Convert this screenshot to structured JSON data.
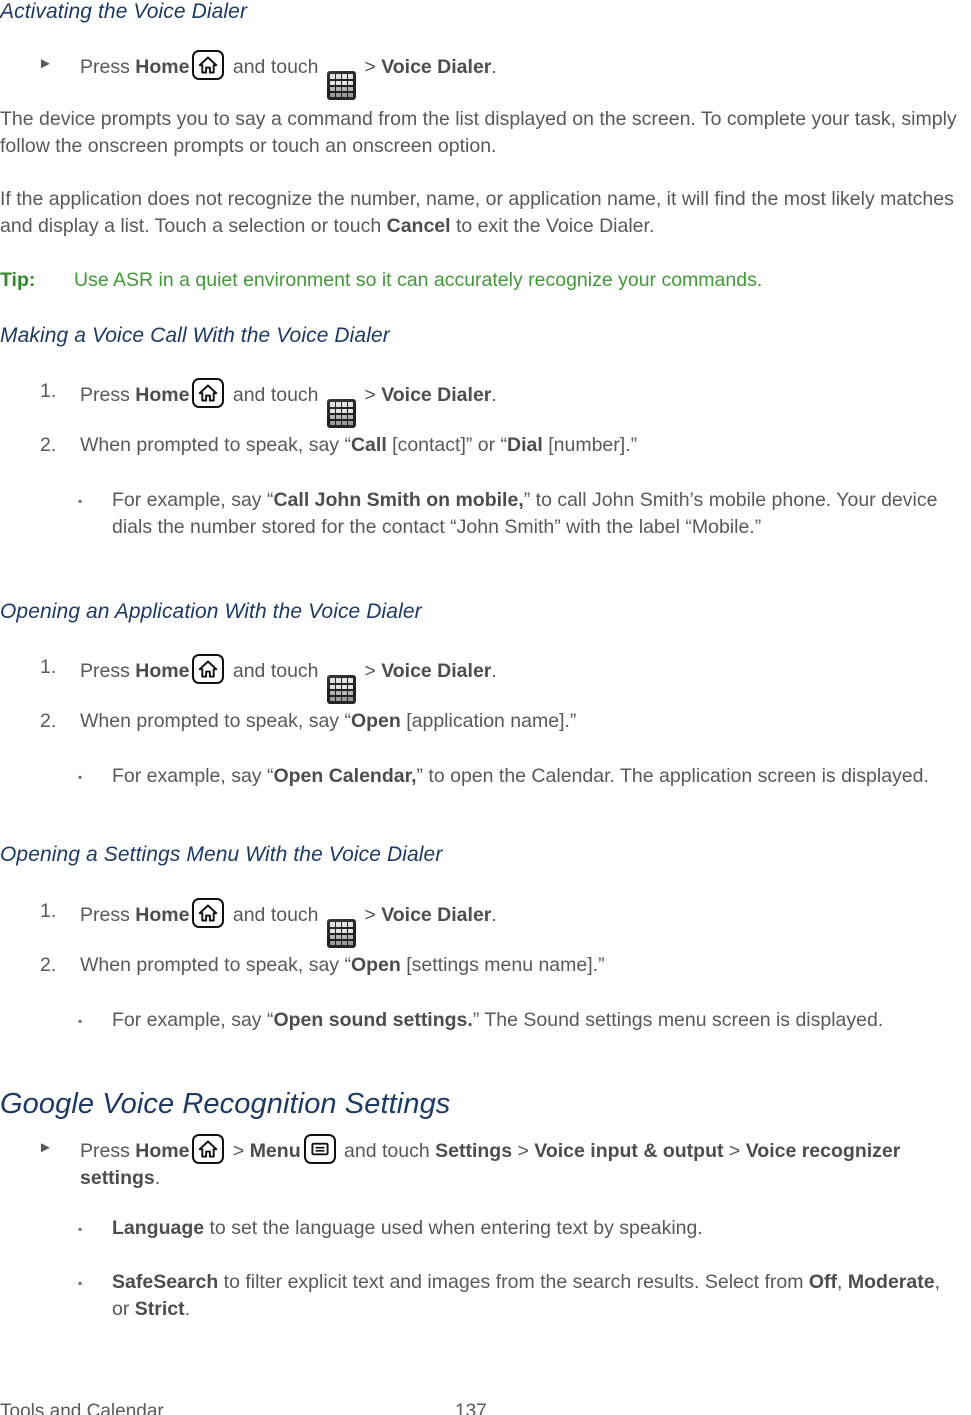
{
  "document": {
    "footer_section": "Tools and Calendar",
    "page_number": "137",
    "colors": {
      "heading": "#1b3a66",
      "body_text": "#58595b",
      "bold_text": "#4d4d4d",
      "tip_green": "#3f9c35"
    }
  },
  "sections": {
    "activating": {
      "heading": "Activating the Voice Dialer",
      "step": {
        "marker": "►",
        "pre": "Press ",
        "bold1": "Home",
        "mid": " and touch ",
        "sep": " > ",
        "bold2": "Voice Dialer",
        "end": "."
      },
      "para1": "The device prompts you to say a command from the list displayed on the screen. To complete your task, simply follow the onscreen prompts or touch an onscreen option.",
      "para2_a": "If the application does not recognize the number, name, or application name, it will find the most likely matches and display a list. Touch a selection or touch ",
      "para2_bold": "Cancel",
      "para2_b": " to exit the Voice Dialer.",
      "tip_label": "Tip:",
      "tip_text": "Use ASR in a quiet environment so it can accurately recognize your commands."
    },
    "making_call": {
      "heading": "Making a Voice Call With the Voice Dialer",
      "step1": {
        "num": "1.",
        "pre": "Press ",
        "bold1": "Home",
        "mid": " and touch ",
        "sep": " > ",
        "bold2": "Voice Dialer",
        "end": "."
      },
      "step2": {
        "num": "2.",
        "pre": "When prompted to speak, say “",
        "bold1": "Call",
        "mid": " [contact]” or “",
        "bold2": "Dial",
        "end": " [number].”"
      },
      "bullet1": {
        "marker": "▪",
        "pre": "For example, say “",
        "bold": "Call John Smith on mobile,",
        "post": "” to call John Smith’s mobile phone. Your device dials the number stored for the contact “John Smith” with the label “Mobile.”"
      }
    },
    "opening_app": {
      "heading": "Opening an Application With the Voice Dialer",
      "step1": {
        "num": "1.",
        "pre": "Press ",
        "bold1": "Home",
        "mid": " and touch ",
        "sep": " > ",
        "bold2": "Voice Dialer",
        "end": "."
      },
      "step2": {
        "num": "2.",
        "pre": "When prompted to speak, say “",
        "bold1": "Open",
        "end": " [application name].”"
      },
      "bullet1": {
        "marker": "▪",
        "pre": "For example, say “",
        "bold": "Open Calendar,",
        "post": "” to open the Calendar. The application screen is displayed."
      }
    },
    "opening_settings": {
      "heading": "Opening a Settings Menu With the Voice Dialer",
      "step1": {
        "num": "1.",
        "pre": "Press ",
        "bold1": "Home",
        "mid": " and touch ",
        "sep": " > ",
        "bold2": "Voice Dialer",
        "end": "."
      },
      "step2": {
        "num": "2.",
        "pre": "When prompted to speak, say “",
        "bold1": "Open",
        "end": " [settings menu name].”"
      },
      "bullet1": {
        "marker": "▪",
        "pre": "For example, say “",
        "bold": "Open sound settings.",
        "post": "” The Sound settings menu screen is displayed."
      }
    },
    "google_voice": {
      "heading": "Google Voice Recognition Settings",
      "step": {
        "marker": "►",
        "pre": "Press ",
        "bold1": "Home",
        "sep1": " > ",
        "bold2": "Menu",
        "mid": " and touch ",
        "bold3": "Settings",
        "sep2": " > ",
        "bold4": "Voice input & output",
        "sep3": " > ",
        "bold5": "Voice recognizer settings",
        "end": "."
      },
      "bullet1": {
        "marker": "▪",
        "bold": "Language",
        "post": " to set the language used when entering text by speaking."
      },
      "bullet2": {
        "marker": "▪",
        "bold1": "SafeSearch",
        "mid1": " to filter explicit text and images from the search results. Select from ",
        "bold2": "Off",
        "mid2": ", ",
        "bold3": "Moderate",
        "mid3": ", or ",
        "bold4": "Strict",
        "end": "."
      }
    }
  },
  "icons": {
    "home": "home-key-icon",
    "apps": "apps-grid-icon",
    "menu": "menu-key-icon"
  }
}
